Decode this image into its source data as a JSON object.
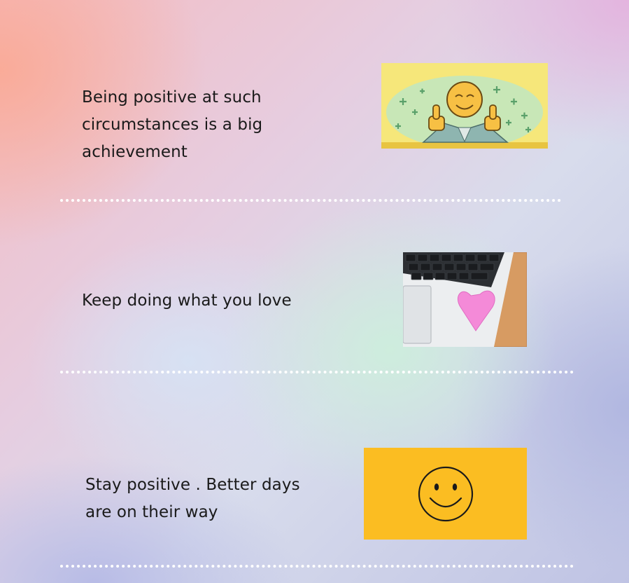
{
  "cards": [
    {
      "text_line1": "Being positive at such",
      "text_line2": "circumstances is a big",
      "text_line3": "achievement",
      "image": "thumbs-up-smiley-icon"
    },
    {
      "text_line1": "Keep doing what you love",
      "image": "laptop-heart-note-icon"
    },
    {
      "text_line1": "Stay positive . Better days",
      "text_line2": "are on their way",
      "image": "smiley-face-icon"
    }
  ],
  "colors": {
    "smiley_yellow": "#fbbd22",
    "thumbs_bg": "#f6e77a",
    "heart_pink": "#f48ad8",
    "divider": "#ffffff"
  }
}
